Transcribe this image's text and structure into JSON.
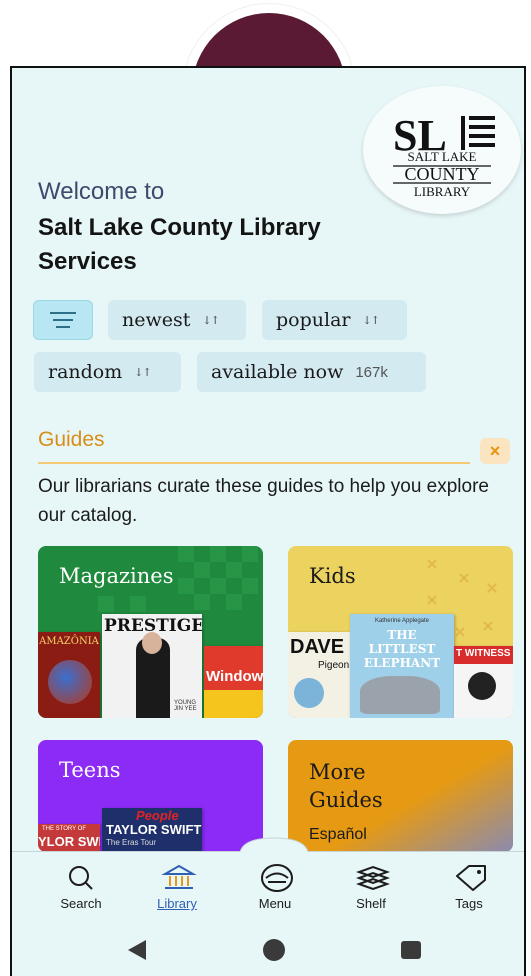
{
  "header": {
    "welcome": "Welcome to",
    "library_name": "Salt Lake County Library Services",
    "logo_text_line1": "SALT LAKE",
    "logo_text_line2": "COUNTY",
    "logo_text_line3": "LIBRARY",
    "logo_monogram": "SL"
  },
  "filters": {
    "chips": [
      {
        "label": "newest",
        "sort_icon": "↓↑"
      },
      {
        "label": "popular",
        "sort_icon": "↓↑"
      },
      {
        "label": "random",
        "sort_icon": "↓↑"
      },
      {
        "label": "available now",
        "count": "167k"
      }
    ]
  },
  "guides": {
    "title": "Guides",
    "close_label": "×",
    "description": "Our librarians curate these guides to help you explore our catalog.",
    "cards": [
      {
        "title": "Magazines",
        "color": "#1f8a3d"
      },
      {
        "title": "Kids",
        "color": "#ecd35f"
      },
      {
        "title": "Teens",
        "color": "#8b2bf5"
      },
      {
        "title": "More Guides",
        "subtitle": "Español",
        "color": "#e69a13"
      }
    ]
  },
  "cover_text": {
    "amazonia": "AMAZÔNIA",
    "prestige": "PRESTIGE",
    "young": "YOUNG JIN YEE",
    "window": "Window",
    "dave": "DAVE",
    "pigeon": "Pigeon",
    "littlest": "THE LITTLEST ELEPHANT",
    "author": "Katherine Applegate",
    "witness": "T WITNESS",
    "people": "People",
    "taylor": "TAYLOR SWIFT",
    "erastour": "The Eras Tour",
    "ylor": "YLOR SWIF",
    "story": "THE STORY OF"
  },
  "bottom_nav": {
    "items": [
      {
        "label": "Search",
        "icon": "search-icon"
      },
      {
        "label": "Library",
        "icon": "library-icon",
        "active": true
      },
      {
        "label": "Menu",
        "icon": "menu-icon"
      },
      {
        "label": "Shelf",
        "icon": "shelf-icon"
      },
      {
        "label": "Tags",
        "icon": "tag-icon"
      }
    ]
  },
  "colors": {
    "background": "#e7f6f7",
    "accent": "#d88e17",
    "chip": "#d3eaf1",
    "active_nav": "#2f5fb3"
  }
}
